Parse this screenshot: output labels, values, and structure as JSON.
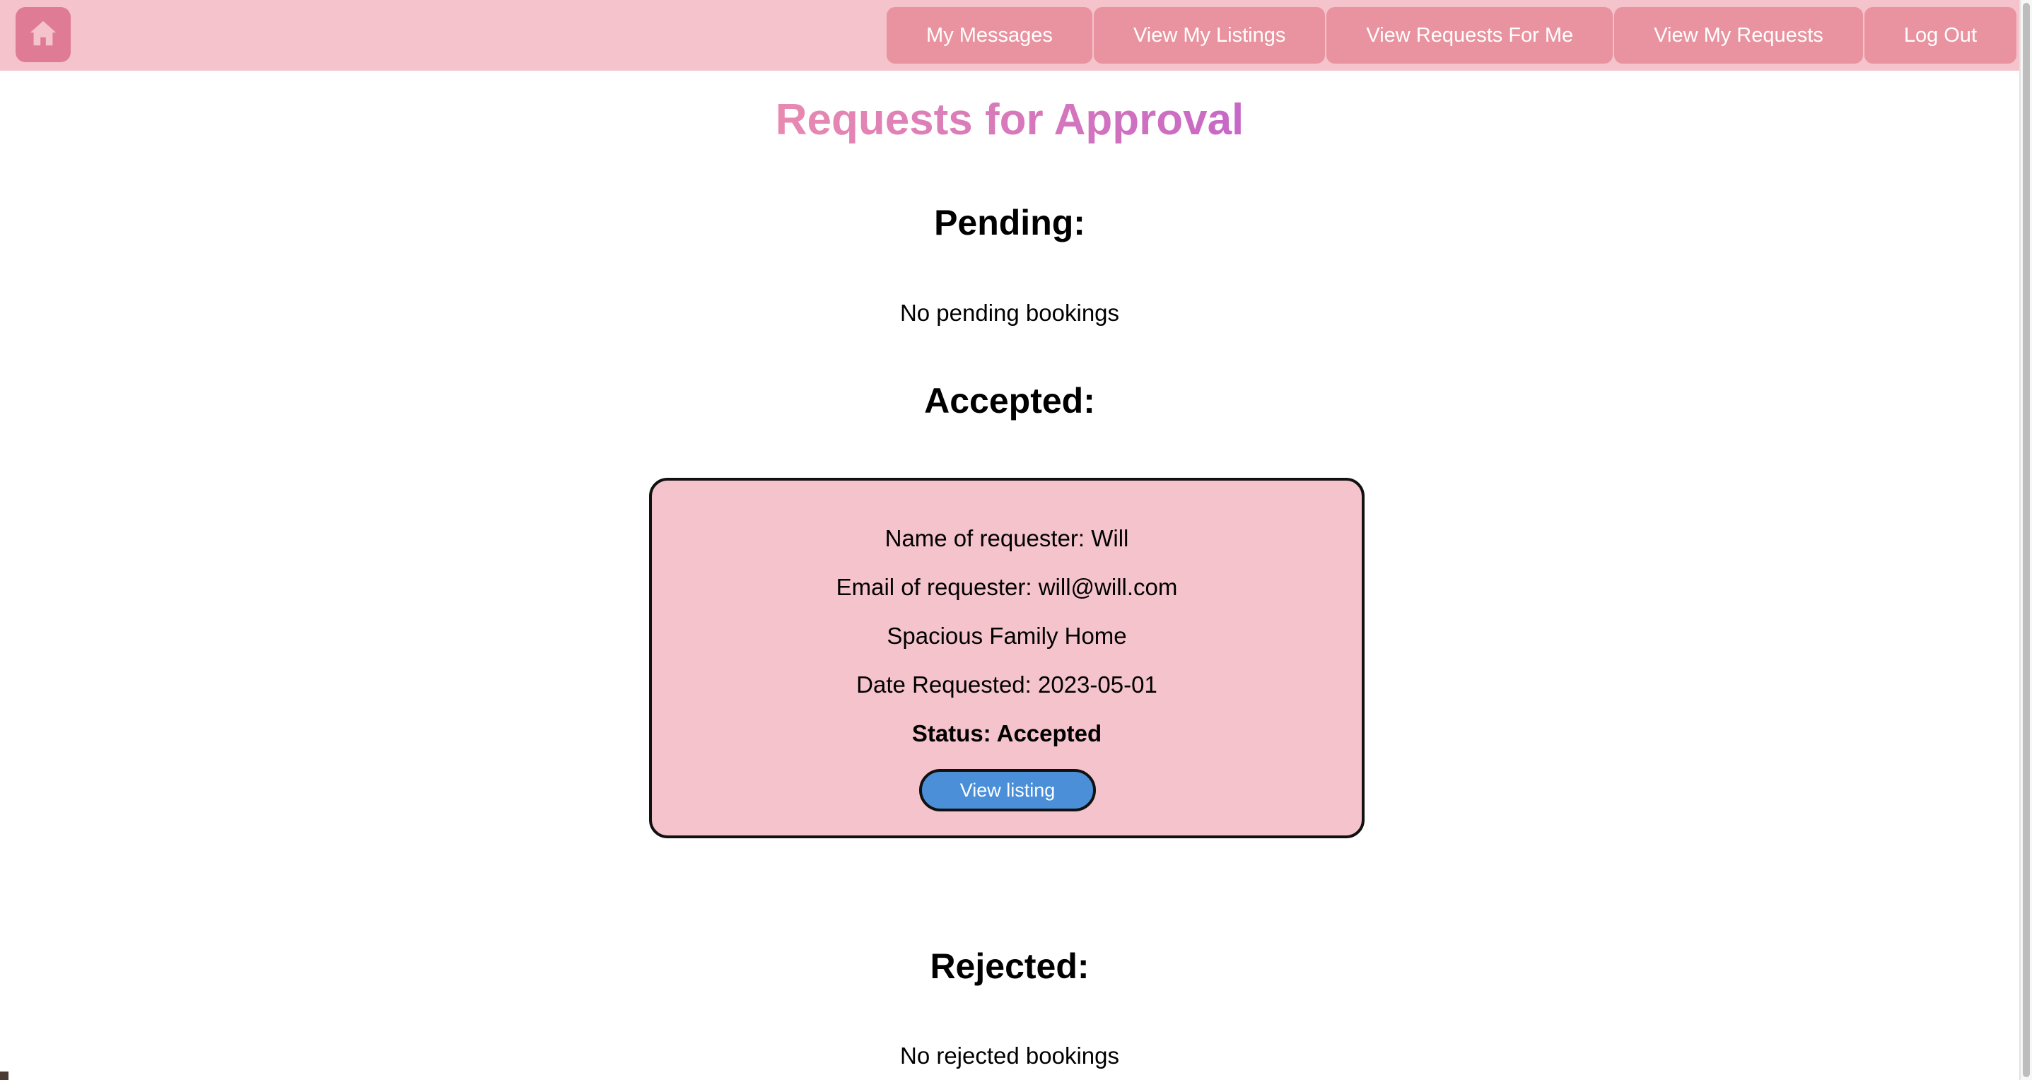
{
  "navbar": {
    "home_icon": "home-icon",
    "buttons": [
      {
        "label": "My Messages"
      },
      {
        "label": "View My Listings"
      },
      {
        "label": "View Requests For Me"
      },
      {
        "label": "View My Requests"
      },
      {
        "label": "Log Out"
      }
    ]
  },
  "page": {
    "title": "Requests for Approval"
  },
  "sections": {
    "pending": {
      "heading": "Pending:",
      "empty_text": "No pending bookings"
    },
    "accepted": {
      "heading": "Accepted:",
      "items": [
        {
          "requester_name": "Name of requester: Will",
          "requester_email": "Email of requester: will@will.com",
          "listing_title": "Spacious Family Home",
          "date_requested": "Date Requested: 2023-05-01",
          "status": "Status: Accepted",
          "button_label": "View listing"
        }
      ]
    },
    "rejected": {
      "heading": "Rejected:",
      "empty_text": "No rejected bookings"
    }
  },
  "colors": {
    "navbar_bg": "#f5c3cc",
    "nav_button_bg": "#e8939f",
    "home_button_bg": "#e07b96",
    "card_bg": "#f5c3cc",
    "view_listing_bg": "#4a8fd8",
    "title_gradient_start": "#e88ab0",
    "title_gradient_end": "#c768c6"
  }
}
